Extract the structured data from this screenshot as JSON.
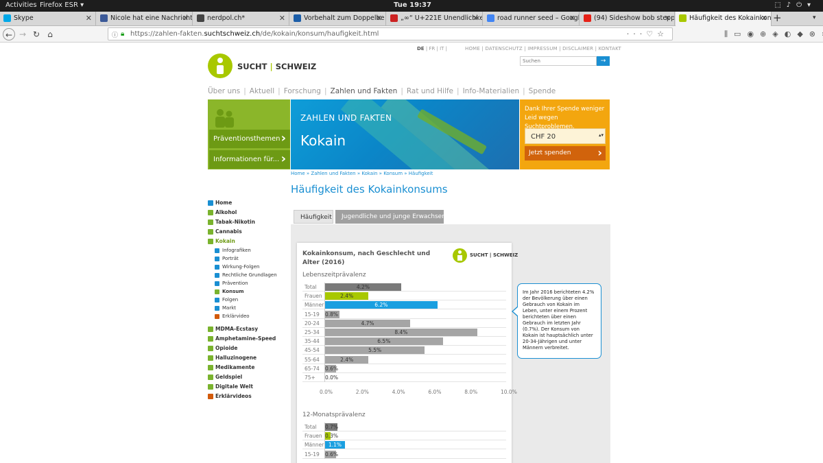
{
  "system": {
    "activities": "Activities",
    "app": "Firefox ESR",
    "clock": "Tue 19:37"
  },
  "tabs": [
    {
      "label": "Skype",
      "color": "#00a8e8"
    },
    {
      "label": "Nicole hat eine Nachricht",
      "color": "#3b5998"
    },
    {
      "label": "nerdpol.ch*",
      "color": "#444444"
    },
    {
      "label": "Vorbehalt zum Doppelbe",
      "color": "#1b5da8"
    },
    {
      "label": "„∞“ U+221E Unendlichke",
      "color": "#cc2222"
    },
    {
      "label": "road runner seed – Googl",
      "color": "#4285f4"
    },
    {
      "label": "(94) Sideshow bob steppi",
      "color": "#e62117"
    },
    {
      "label": "Häufigkeit des Kokainkon",
      "color": "#a8c800"
    }
  ],
  "url": {
    "prefix": "https://zahlen-fakten.",
    "domain": "suchtschweiz.ch",
    "path": "/de/kokain/konsum/haufigkeit.html"
  },
  "site": {
    "lang": {
      "de": "DE",
      "fr": "FR",
      "it": "IT"
    },
    "util": "HOME | DATENSCHUTZ | IMPRESSUM | DISCLAIMER | KONTAKT",
    "logo_a": "SUCHT",
    "logo_b": "SCHWEIZ",
    "search_placeholder": "Suchen",
    "nav": [
      "Über uns",
      "Aktuell",
      "Forschung",
      "Zahlen und Fakten",
      "Rat und Hilfe",
      "Info-Materialien",
      "Spende"
    ],
    "left_btn1": "Präventionsthemen",
    "left_btn2": "Informationen für...",
    "hero_kicker": "ZAHLEN UND FAKTEN",
    "hero_title": "Kokain",
    "donate_text": "Dank Ihrer Spende weniger Leid wegen Suchtproblemen.",
    "donate_amount": "CHF 20",
    "donate_button": "Jetzt spenden",
    "breadcrumb": "Home » Zahlen und Fakten » Kokain » Konsum » Häufigkeit",
    "page_title": "Häufigkeit des Kokainkonsums",
    "tab_active": "Häufigkeit",
    "tab_inactive": "Jugendliche und junge Erwachsene",
    "side": [
      {
        "label": "Home",
        "kind": "home"
      },
      {
        "label": "Alkohol"
      },
      {
        "label": "Tabak-Nikotin"
      },
      {
        "label": "Cannabis"
      },
      {
        "label": "Kokain",
        "sel": true
      },
      {
        "label": "Infografiken",
        "sub": true
      },
      {
        "label": "Porträt",
        "sub": true
      },
      {
        "label": "Wirkung-Folgen",
        "sub": true
      },
      {
        "label": "Rechtliche Grundlagen",
        "sub": true
      },
      {
        "label": "Prävention",
        "sub": true
      },
      {
        "label": "Konsum",
        "sub": true,
        "bold": true
      },
      {
        "label": "Folgen",
        "sub": true
      },
      {
        "label": "Markt",
        "sub": true
      },
      {
        "label": "Erklärvideo",
        "sub": true,
        "video": true
      },
      {
        "label": "MDMA-Ecstasy"
      },
      {
        "label": "Amphetamine-Speed"
      },
      {
        "label": "Opioide"
      },
      {
        "label": "Halluzinogene"
      },
      {
        "label": "Medikamente"
      },
      {
        "label": "Geldspiel"
      },
      {
        "label": "Digitale Welt"
      },
      {
        "label": "Erklärvideos",
        "kind": "video"
      }
    ],
    "callout": "Im Jahr 2016 berichteten 4.2% der Bevölkerung über einen Gebrauch von Kokain im Leben, unter einem Prozent berichteten über einen Gebrauch im letzten Jahr (0.7%). Der Konsum von Kokain ist hauptsächlich unter 20-34-Jährigen und unter Männern verbreitet."
  },
  "chart_data": [
    {
      "type": "bar",
      "title": "Kokainkonsum, nach Geschlecht und Alter (2016)",
      "subtitle": "Lebenszeitprävalenz",
      "categories": [
        "Total",
        "Frauen",
        "Männer",
        "15-19",
        "20-24",
        "25-34",
        "35-44",
        "45-54",
        "55-64",
        "65-74",
        "75+"
      ],
      "values": [
        4.2,
        2.4,
        6.2,
        0.8,
        4.7,
        8.4,
        6.5,
        5.5,
        2.4,
        0.6,
        0.0
      ],
      "labels": [
        "4.2%",
        "2.4%",
        "6.2%",
        "0.8%",
        "4.7%",
        "8.4%",
        "6.5%",
        "5.5%",
        "2.4%",
        "0.6%",
        "0.0%"
      ],
      "colors": [
        "#7a7a7a",
        "#a8c800",
        "#1a9fe0",
        "#a5a5a5",
        "#a5a5a5",
        "#a5a5a5",
        "#a5a5a5",
        "#a5a5a5",
        "#a5a5a5",
        "#a5a5a5",
        "#a5a5a5"
      ],
      "xticks": [
        "0.0%",
        "2.0%",
        "4.0%",
        "6.0%",
        "8.0%",
        "10.0%"
      ],
      "xlim": [
        0,
        10
      ]
    },
    {
      "type": "bar",
      "subtitle": "12-Monatsprävalenz",
      "categories": [
        "Total",
        "Frauen",
        "Männer",
        "15-19"
      ],
      "values": [
        0.7,
        0.3,
        1.1,
        0.6
      ],
      "labels": [
        "0.7%",
        "0.3%",
        "1.1%",
        "0.6%"
      ],
      "colors": [
        "#7a7a7a",
        "#a8c800",
        "#1a9fe0",
        "#a5a5a5"
      ],
      "xlim": [
        0,
        10
      ]
    }
  ]
}
